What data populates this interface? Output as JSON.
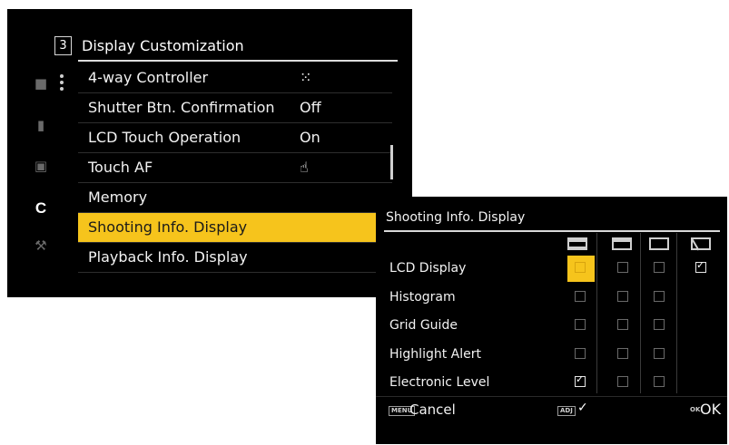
{
  "menu_screen": {
    "page_number": "3",
    "title": "Display Customization",
    "sidebar": {
      "icons": [
        "camera-icon",
        "video-icon",
        "playback-icon",
        "custom-icon",
        "wrench-icon"
      ],
      "custom_letter": "C"
    },
    "items": [
      {
        "label": "4-way Controller",
        "value": "⁙",
        "value_is_icon": true
      },
      {
        "label": "Shutter Btn. Confirmation",
        "value": "Off"
      },
      {
        "label": "LCD Touch Operation",
        "value": "On"
      },
      {
        "label": "Touch AF",
        "value": "☝",
        "value_is_icon": true
      },
      {
        "label": "Memory",
        "value": ""
      },
      {
        "label": "Shooting Info. Display",
        "value": "",
        "selected": true
      },
      {
        "label": "Playback Info. Display",
        "value": ""
      }
    ]
  },
  "info_screen": {
    "title": "Shooting Info. Display",
    "columns": [
      "standard-display-icon",
      "standard-display-2-icon",
      "blank-display-icon",
      "viewfinder-off-icon"
    ],
    "rows": [
      {
        "label": "LCD Display",
        "checks": [
          true,
          false,
          false,
          true
        ]
      },
      {
        "label": "Histogram",
        "checks": [
          false,
          false,
          false
        ]
      },
      {
        "label": "Grid Guide",
        "checks": [
          false,
          false,
          false
        ]
      },
      {
        "label": "Highlight Alert",
        "checks": [
          false,
          false,
          false
        ]
      },
      {
        "label": "Electronic Level",
        "checks": [
          true,
          false,
          false
        ]
      }
    ],
    "footer": {
      "menu_tag": "MENU",
      "cancel_label": "Cancel",
      "adj_tag": "ADJ",
      "adj_symbol": "✓",
      "ok_tag": "OK",
      "ok_label": "OK"
    }
  },
  "colors": {
    "highlight": "#f6c41c",
    "background": "#000000",
    "text": "#f2f2f2"
  }
}
